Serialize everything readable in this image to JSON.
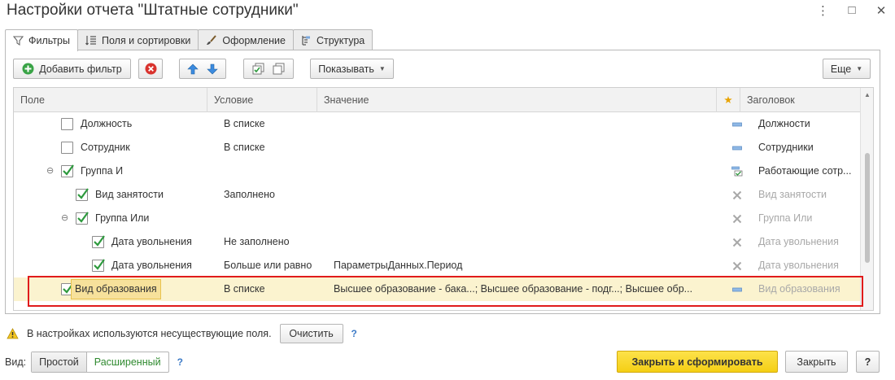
{
  "window": {
    "title": "Настройки отчета \"Штатные сотрудники\"",
    "more_glyph": "⋮",
    "minimize_glyph": "□",
    "close_glyph": "✕"
  },
  "tabs": [
    {
      "label": "Фильтры",
      "icon": "funnel-icon",
      "active": true
    },
    {
      "label": "Поля и сортировки",
      "icon": "fields-sort-icon",
      "active": false
    },
    {
      "label": "Оформление",
      "icon": "brush-icon",
      "active": false
    },
    {
      "label": "Структура",
      "icon": "structure-icon",
      "active": false
    }
  ],
  "toolbar": {
    "add_filter_label": "Добавить фильтр",
    "show_label": "Показывать",
    "more_label": "Еще"
  },
  "grid": {
    "headers": {
      "field": "Поле",
      "condition": "Условие",
      "value": "Значение",
      "mark": "★",
      "caption": "Заголовок"
    },
    "rows": [
      {
        "field": "Должность",
        "condition": "В списке",
        "value": "",
        "caption": "Должности",
        "checked": false,
        "level": 1,
        "toggle": "",
        "mark": "dash",
        "caption_dim": false
      },
      {
        "field": "Сотрудник",
        "condition": "В списке",
        "value": "",
        "caption": "Сотрудники",
        "checked": false,
        "level": 1,
        "toggle": "",
        "mark": "dash",
        "caption_dim": false
      },
      {
        "field": "Группа И",
        "condition": "",
        "value": "",
        "caption": "Работающие сотр...",
        "checked": true,
        "level": 1,
        "toggle": "⊖",
        "mark": "group",
        "caption_dim": false
      },
      {
        "field": "Вид занятости",
        "condition": "Заполнено",
        "value": "",
        "caption": "Вид занятости",
        "checked": true,
        "level": 2,
        "toggle": "",
        "mark": "x",
        "caption_dim": true
      },
      {
        "field": "Группа Или",
        "condition": "",
        "value": "",
        "caption": "Группа Или",
        "checked": true,
        "level": 2,
        "toggle": "⊖",
        "mark": "x",
        "caption_dim": true
      },
      {
        "field": "Дата увольнения",
        "condition": "Не заполнено",
        "value": "",
        "caption": "Дата увольнения",
        "checked": true,
        "level": 3,
        "toggle": "",
        "mark": "x",
        "caption_dim": true
      },
      {
        "field": "Дата увольнения",
        "condition": "Больше или равно",
        "value": "ПараметрыДанных.Период",
        "caption": "Дата увольнения",
        "checked": true,
        "level": 3,
        "toggle": "",
        "mark": "x",
        "caption_dim": true
      },
      {
        "field": "Вид образования",
        "condition": "В списке",
        "value": "Высшее образование - бака...; Высшее образование - подг...; Высшее обр...",
        "caption": "Вид образования",
        "checked": true,
        "level": 0,
        "toggle": "",
        "mark": "dash",
        "caption_dim": true,
        "selected": true
      }
    ]
  },
  "footer": {
    "warning_text": "В настройках используются несуществующие поля.",
    "clear_label": "Очистить",
    "help_glyph": "?",
    "view_label": "Вид:",
    "view_simple": "Простой",
    "view_extended": "Расширенный",
    "close_and_build_label": "Закрыть и сформировать",
    "close_label": "Закрыть",
    "help_button_glyph": "?"
  },
  "colors": {
    "accent_yellow": "#f7d31f",
    "selection_row": "#fbf3cf",
    "highlight_box": "#e01b1b",
    "check_green": "#2e9a3e",
    "mark_blue": "#6f9fd6"
  }
}
